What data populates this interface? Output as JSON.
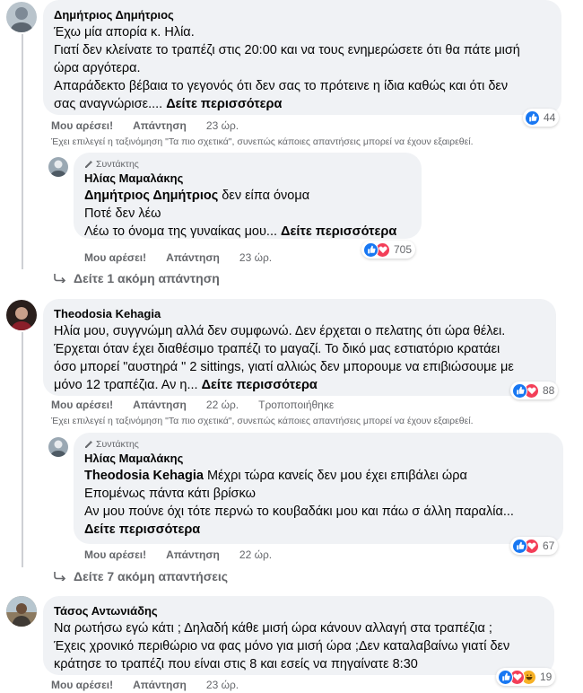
{
  "colors": {
    "accent": "#1877f2",
    "love": "#f33e58",
    "haha": "#f7b125",
    "bubble": "#f0f2f5",
    "meta": "#65676b"
  },
  "labels": {
    "like": "Μου αρέσει!",
    "reply": "Απάντηση",
    "author_badge": "Συντάκτης",
    "edited": "Τροποποιήθηκε"
  },
  "notice": "Έχει επιλεγεί η ταξινόμηση \"Τα πιο σχετικά\", συνεπώς κάποιες απαντήσεις μπορεί να έχουν εξαιρεθεί.",
  "c1": {
    "author": "Δημήτριος Δημήτριος",
    "lines": [
      "Έχω μία απορία κ. Ηλία.",
      "Γιατί δεν κλείνατε το τραπέζι στις 20:00 και να τους ενημερώσετε ότι θα πάτε μισή",
      "ώρα αργότερα.",
      "Απαράδεκτο βέβαια το γεγονός ότι δεν σας το πρότεινε η ίδια καθώς και ότι δεν",
      "σας αναγνώρισε.... "
    ],
    "see_more": "Δείτε περισσότερα",
    "time": "23 ώρ.",
    "reactions": {
      "count": "44",
      "icons": [
        "like-icon"
      ]
    }
  },
  "r1": {
    "author": "Ηλίας Μαμαλάκης",
    "mention": "Δημήτριος Δημήτριος",
    "mention_rest": " δεν είπα όνομα",
    "lines": [
      "Ποτέ δεν λέω",
      "Λέω το όνομα της γυναίκας μου... "
    ],
    "see_more": "Δείτε περισσότερα",
    "time": "23 ώρ.",
    "reactions": {
      "count": "705",
      "icons": [
        "like-icon",
        "love-icon"
      ]
    },
    "more_replies": "Δείτε 1 ακόμη απάντηση"
  },
  "c2": {
    "author": "Theodosia Kehagia",
    "lines": [
      "Ηλία μου, συγγνώμη αλλά δεν συμφωνώ. Δεν έρχεται ο πελατης ότι ώρα θέλει.",
      "Έρχεται όταν έχει διαθέσιμο τραπέζι το μαγαζί. Το δικό μας εστιατόριο κρατάει",
      "όσο μπορεί \"αυστηρά \" 2 sittings, γιατί αλλιώς δεν μπορουμε να επιβιώσουμε με",
      "μόνο 12 τραπέζια. Αν η... "
    ],
    "see_more": "Δείτε περισσότερα",
    "time": "22 ώρ.",
    "reactions": {
      "count": "88",
      "icons": [
        "like-icon",
        "love-icon"
      ]
    }
  },
  "r2": {
    "author": "Ηλίας Μαμαλάκης",
    "mention": "Theodosia Kehagia",
    "mention_rest": " Μέχρι τώρα κανείς δεν μου έχει επιβάλει ώρα",
    "lines": [
      "Επομένως πάντα κάτι βρίσκω",
      "Αν μου πούνε όχι τότε περνώ το κουβαδάκι μου και πάω σ άλλη παραλία..."
    ],
    "see_more": "Δείτε περισσότερα",
    "time": "22 ώρ.",
    "reactions": {
      "count": "67",
      "icons": [
        "like-icon",
        "love-icon"
      ]
    },
    "more_replies": "Δείτε 7 ακόμη απαντήσεις"
  },
  "c3": {
    "author": "Τάσος Αντωνιάδης",
    "lines": [
      "Να ρωτήσω εγώ κάτι ; Δηλαδή κάθε μισή ώρα κάνουν αλλαγή στα τραπέζια ;",
      "Έχεις χρονικό περιθώριο να φας μόνο για μισή ώρα ;Δεν καταλαβαίνω γιατί δεν",
      "κράτησε το τραπέζι που είναι στις 8 και εσείς να πηγαίνατε 8:30"
    ],
    "time": "23 ώρ.",
    "reactions": {
      "count": "19",
      "icons": [
        "like-icon",
        "love-icon",
        "haha-icon"
      ]
    }
  }
}
